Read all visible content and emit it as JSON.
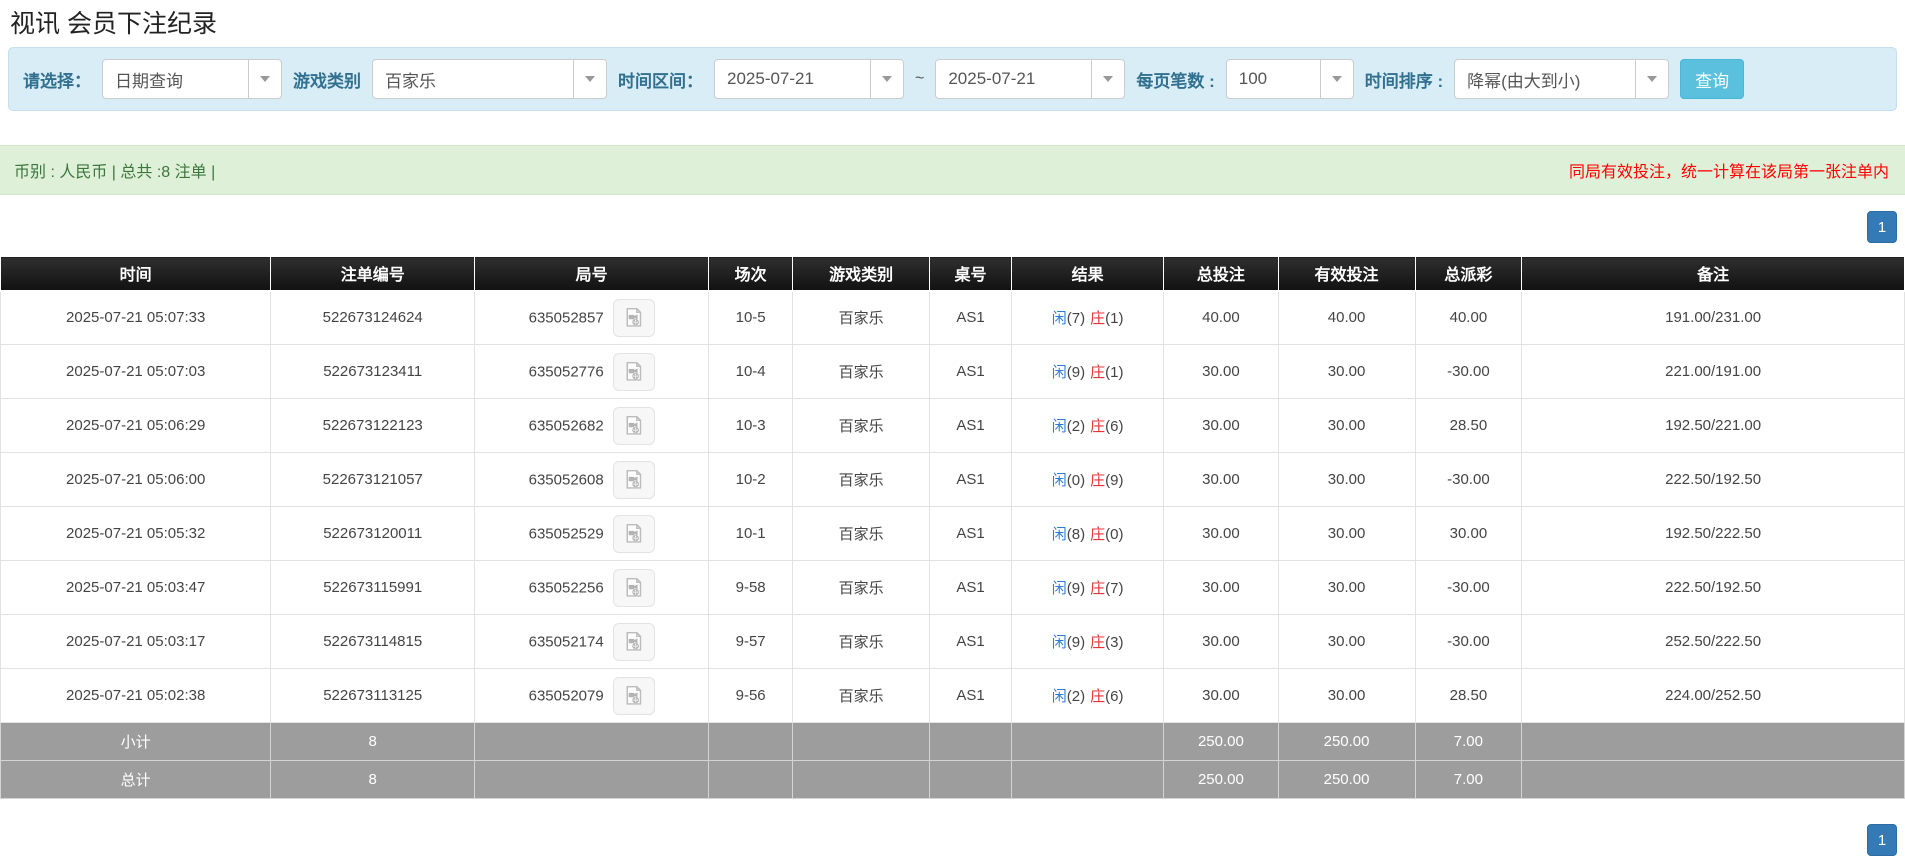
{
  "page": {
    "title": "视讯 会员下注纪录"
  },
  "filters": {
    "select_label": "请选择：",
    "select_value": "日期查询",
    "game_type_label": "游戏类别",
    "game_type_value": "百家乐",
    "time_range_label": "时间区间：",
    "date_from": "2025-07-21",
    "range_separator": "~",
    "date_to": "2025-07-21",
    "page_size_label": "每页笔数 :",
    "page_size_value": "100",
    "time_sort_label": "时间排序 :",
    "time_sort_value": "降幂(由大到小)",
    "search_button": "查询"
  },
  "info_bar": {
    "left_text": "币别 : 人民币 | 总共 :8 注单 |",
    "right_text": "同局有效投注，统一计算在该局第一张注单内"
  },
  "pagination": {
    "page": "1"
  },
  "table": {
    "headers": [
      "时间",
      "注单编号",
      "局号",
      "场次",
      "游戏类别",
      "桌号",
      "结果",
      "总投注",
      "有效投注",
      "总派彩",
      "备注"
    ],
    "rows": [
      {
        "time": "2025-07-21 05:07:33",
        "bet_id": "522673124624",
        "round_id": "635052857",
        "session": "10-5",
        "game": "百家乐",
        "table_id": "AS1",
        "result": {
          "player_label": "闲",
          "player_score": "(7)",
          "banker_label": "庄",
          "banker_score": "(1)"
        },
        "total_bet": "40.00",
        "valid_bet": "40.00",
        "payout": "40.00",
        "remark": "191.00/231.00"
      },
      {
        "time": "2025-07-21 05:07:03",
        "bet_id": "522673123411",
        "round_id": "635052776",
        "session": "10-4",
        "game": "百家乐",
        "table_id": "AS1",
        "result": {
          "player_label": "闲",
          "player_score": "(9)",
          "banker_label": "庄",
          "banker_score": "(1)"
        },
        "total_bet": "30.00",
        "valid_bet": "30.00",
        "payout": "-30.00",
        "remark": "221.00/191.00"
      },
      {
        "time": "2025-07-21 05:06:29",
        "bet_id": "522673122123",
        "round_id": "635052682",
        "session": "10-3",
        "game": "百家乐",
        "table_id": "AS1",
        "result": {
          "player_label": "闲",
          "player_score": "(2)",
          "banker_label": "庄",
          "banker_score": "(6)"
        },
        "total_bet": "30.00",
        "valid_bet": "30.00",
        "payout": "28.50",
        "remark": "192.50/221.00"
      },
      {
        "time": "2025-07-21 05:06:00",
        "bet_id": "522673121057",
        "round_id": "635052608",
        "session": "10-2",
        "game": "百家乐",
        "table_id": "AS1",
        "result": {
          "player_label": "闲",
          "player_score": "(0)",
          "banker_label": "庄",
          "banker_score": "(9)"
        },
        "total_bet": "30.00",
        "valid_bet": "30.00",
        "payout": "-30.00",
        "remark": "222.50/192.50"
      },
      {
        "time": "2025-07-21 05:05:32",
        "bet_id": "522673120011",
        "round_id": "635052529",
        "session": "10-1",
        "game": "百家乐",
        "table_id": "AS1",
        "result": {
          "player_label": "闲",
          "player_score": "(8)",
          "banker_label": "庄",
          "banker_score": "(0)"
        },
        "total_bet": "30.00",
        "valid_bet": "30.00",
        "payout": "30.00",
        "remark": "192.50/222.50"
      },
      {
        "time": "2025-07-21 05:03:47",
        "bet_id": "522673115991",
        "round_id": "635052256",
        "session": "9-58",
        "game": "百家乐",
        "table_id": "AS1",
        "result": {
          "player_label": "闲",
          "player_score": "(9)",
          "banker_label": "庄",
          "banker_score": "(7)"
        },
        "total_bet": "30.00",
        "valid_bet": "30.00",
        "payout": "-30.00",
        "remark": "222.50/192.50"
      },
      {
        "time": "2025-07-21 05:03:17",
        "bet_id": "522673114815",
        "round_id": "635052174",
        "session": "9-57",
        "game": "百家乐",
        "table_id": "AS1",
        "result": {
          "player_label": "闲",
          "player_score": "(9)",
          "banker_label": "庄",
          "banker_score": "(3)"
        },
        "total_bet": "30.00",
        "valid_bet": "30.00",
        "payout": "-30.00",
        "remark": "252.50/222.50"
      },
      {
        "time": "2025-07-21 05:02:38",
        "bet_id": "522673113125",
        "round_id": "635052079",
        "session": "9-56",
        "game": "百家乐",
        "table_id": "AS1",
        "result": {
          "player_label": "闲",
          "player_score": "(2)",
          "banker_label": "庄",
          "banker_score": "(6)"
        },
        "total_bet": "30.00",
        "valid_bet": "30.00",
        "payout": "28.50",
        "remark": "224.00/252.50"
      }
    ],
    "subtotal": {
      "label": "小计",
      "count": "8",
      "total_bet": "250.00",
      "valid_bet": "250.00",
      "payout": "7.00"
    },
    "total": {
      "label": "总计",
      "count": "8",
      "total_bet": "250.00",
      "valid_bet": "250.00",
      "payout": "7.00"
    }
  },
  "colors": {
    "accent_blue": "#337ab7",
    "link_blue": "#2d7bdb",
    "banker_red": "#e53333",
    "negative_red": "#ff0000",
    "info_bg": "#d9edf7",
    "success_bg": "#dff0d8",
    "btn_info": "#5bc0de",
    "summary_gray": "#9d9d9d"
  }
}
